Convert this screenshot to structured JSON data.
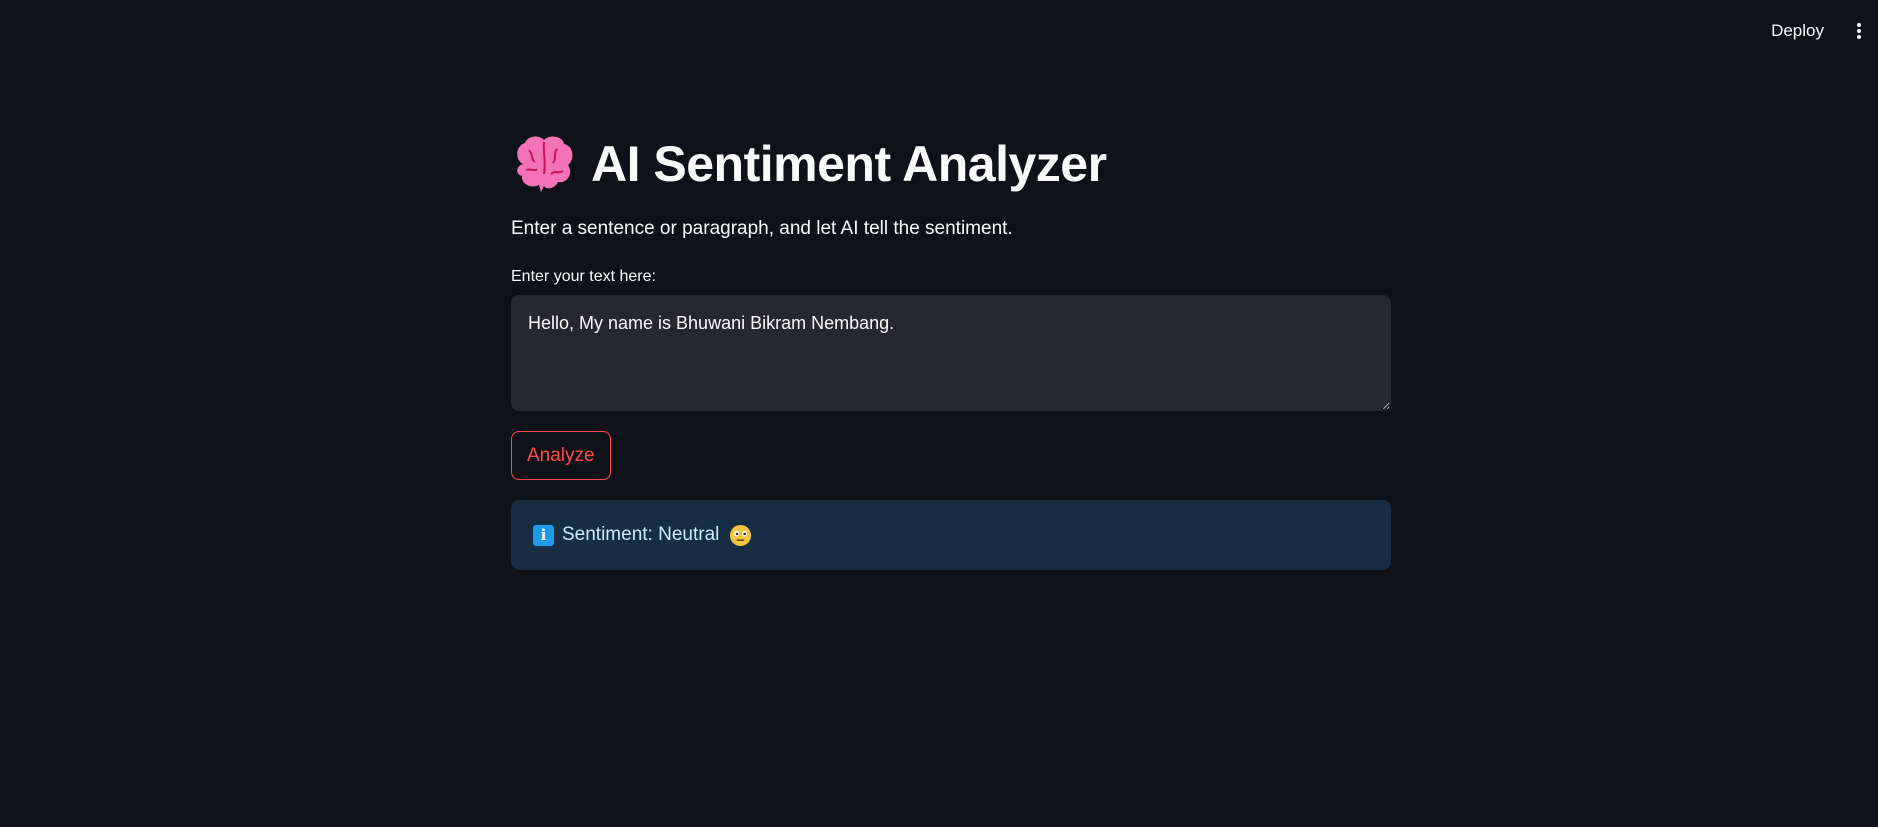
{
  "toolbar": {
    "deploy_label": "Deploy",
    "menu_icon": "vertical-ellipsis-icon"
  },
  "header": {
    "title_icon": "brain-icon",
    "title": "AI Sentiment Analyzer",
    "subtitle": "Enter a sentence or paragraph, and let AI tell the sentiment."
  },
  "form": {
    "input_label": "Enter your text here:",
    "input_value": "Hello, My name is Bhuwani Bikram Nembang.",
    "analyze_label": "Analyze"
  },
  "result": {
    "icon": "info-icon",
    "text": "Sentiment: Neutral",
    "emoji_icon": "neutral-face-icon"
  },
  "colors": {
    "background": "#0e1117",
    "input_background": "#262730",
    "accent": "#ff4b4b",
    "info_background": "#172d43",
    "info_text": "#c7ebff"
  }
}
